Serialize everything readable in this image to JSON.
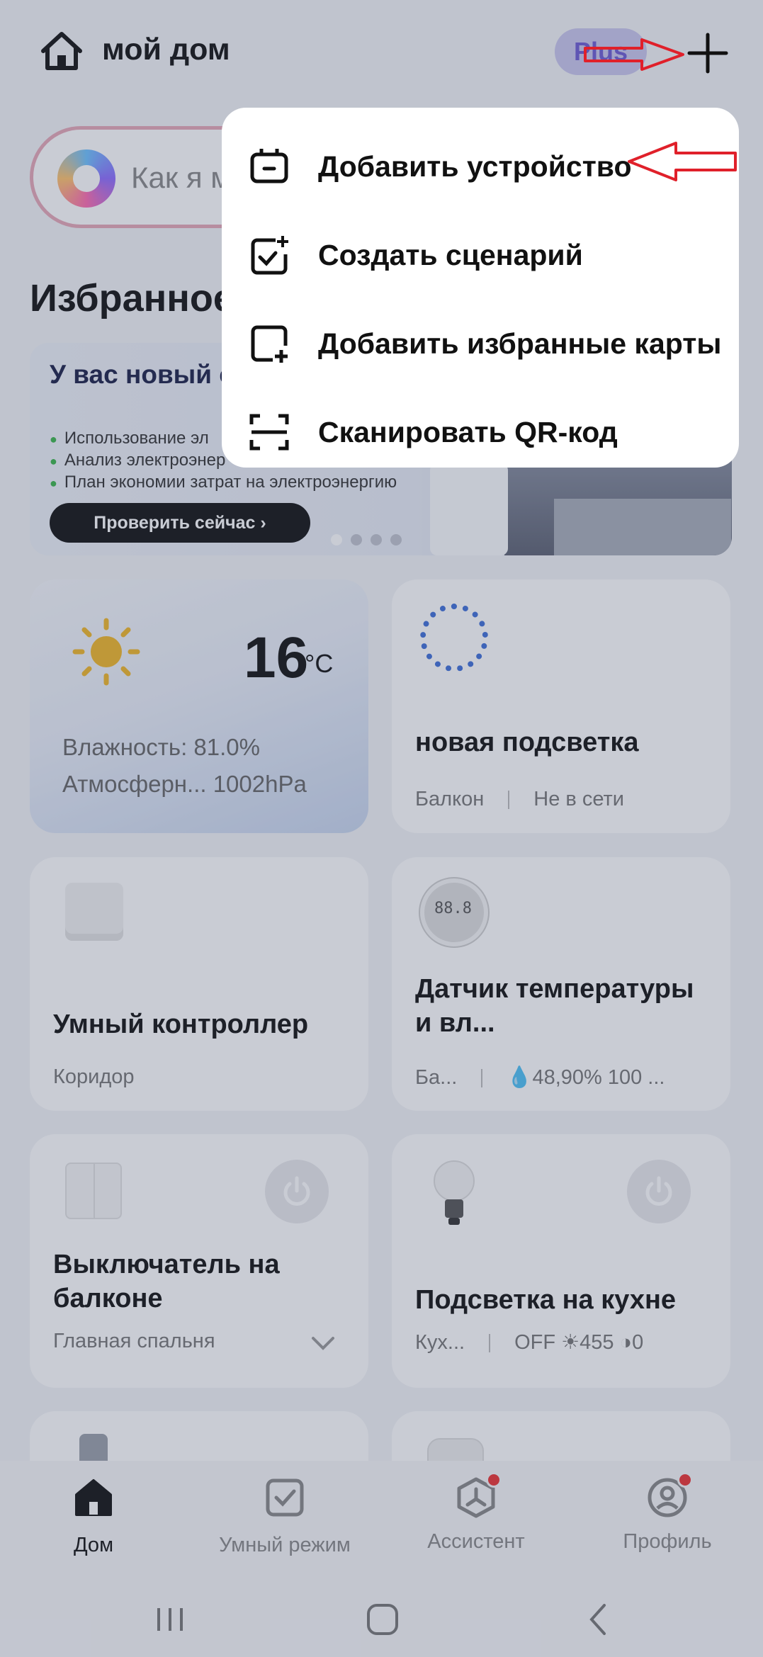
{
  "header": {
    "title": "мой дом",
    "plus_label": "Plus",
    "home_icon": "home-icon",
    "add_icon": "add-icon"
  },
  "assistant": {
    "placeholder": "Как я м"
  },
  "favorites": {
    "title": "Избранное"
  },
  "banner": {
    "title": "У вас новый с энергосбереж",
    "bullets": [
      "Использование эл",
      "Анализ электроэнер",
      "План экономии затрат на электроэнергию"
    ],
    "button_label": "Проверить сейчас ›"
  },
  "cards": {
    "weather": {
      "temperature": "16",
      "unit": "°C",
      "humidity": "Влажность: 81.0%",
      "pressure": "Атмосферн...  1002hPa"
    },
    "light_new": {
      "name": "новая подсветка",
      "room": "Балкон",
      "status": "Не в сети"
    },
    "controller": {
      "name": "Умный контроллер",
      "room": "Коридор"
    },
    "thermo": {
      "name": "Датчик температуры и вл...",
      "room": "Ба...",
      "reading": "💧48,90%  100  ..."
    },
    "switch": {
      "name": "Выключатель на балконе",
      "room": "Главная спальня"
    },
    "kitchen": {
      "name": "Подсветка на кухне",
      "room": "Кух...",
      "state": "OFF  ☀455  ◑0"
    }
  },
  "menu": {
    "items": [
      {
        "label": "Добавить устройство",
        "icon": "add-device-icon"
      },
      {
        "label": "Создать сценарий",
        "icon": "create-scene-icon"
      },
      {
        "label": "Добавить избранные карты",
        "icon": "add-card-icon"
      },
      {
        "label": "Сканировать QR-код",
        "icon": "scan-qr-icon"
      }
    ]
  },
  "tabs": [
    {
      "label": "Дом",
      "icon": "home-tab-icon",
      "active": true
    },
    {
      "label": "Умный режим",
      "icon": "smart-mode-icon"
    },
    {
      "label": "Ассистент",
      "icon": "assistant-icon"
    },
    {
      "label": "Профиль",
      "icon": "profile-icon"
    }
  ],
  "colors": {
    "accent_red": "#e0202a",
    "plus_purple": "#6d5bd3",
    "badge_red": "#e33333"
  }
}
